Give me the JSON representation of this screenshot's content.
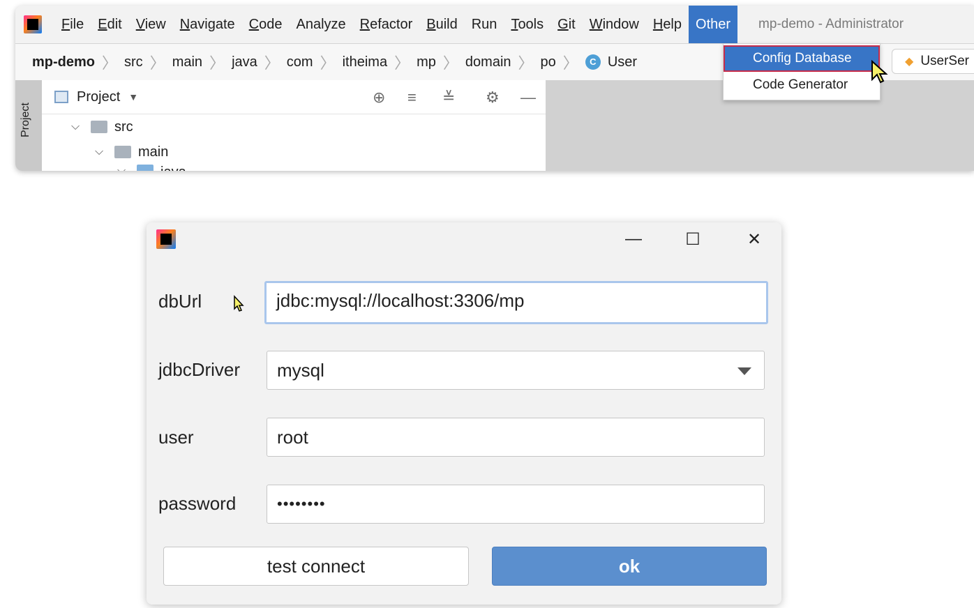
{
  "ide": {
    "menu": [
      {
        "label": "File",
        "mn": "F",
        "rest": "ile"
      },
      {
        "label": "Edit",
        "mn": "E",
        "rest": "dit"
      },
      {
        "label": "View",
        "mn": "V",
        "rest": "iew"
      },
      {
        "label": "Navigate",
        "mn": "N",
        "rest": "avigate"
      },
      {
        "label": "Code",
        "mn": "C",
        "rest": "ode"
      },
      {
        "label": "Analyze",
        "mn": "",
        "rest": "Analyze"
      },
      {
        "label": "Refactor",
        "mn": "R",
        "rest": "efactor"
      },
      {
        "label": "Build",
        "mn": "B",
        "rest": "uild"
      },
      {
        "label": "Run",
        "mn": "",
        "rest": "Run"
      },
      {
        "label": "Tools",
        "mn": "T",
        "rest": "ools"
      },
      {
        "label": "Git",
        "mn": "G",
        "rest": "it"
      },
      {
        "label": "Window",
        "mn": "W",
        "rest": "indow"
      },
      {
        "label": "Help",
        "mn": "H",
        "rest": "elp"
      },
      {
        "label": "Other",
        "mn": "",
        "rest": "Other"
      }
    ],
    "window_title": "mp-demo - Administrator",
    "breadcrumbs": [
      "mp-demo",
      "src",
      "main",
      "java",
      "com",
      "itheima",
      "mp",
      "domain",
      "po",
      "User"
    ],
    "class_icon_letter": "C",
    "editor_tab": "UserSer",
    "project_panel": {
      "title": "Project",
      "side_label": "Project",
      "tree": [
        {
          "label": "src"
        },
        {
          "label": "main"
        },
        {
          "label": "java"
        }
      ]
    },
    "other_menu": {
      "items": [
        "Config Database",
        "Code Generator"
      ]
    }
  },
  "dialog": {
    "fields": {
      "dbUrl": {
        "label": "dbUrl",
        "value": "jdbc:mysql://localhost:3306/mp"
      },
      "jdbcDriver": {
        "label": "jdbcDriver",
        "value": "mysql"
      },
      "user": {
        "label": "user",
        "value": "root"
      },
      "password": {
        "label": "password",
        "value": "••••••••"
      }
    },
    "buttons": {
      "test": "test connect",
      "ok": "ok"
    }
  },
  "colors": {
    "accent": "#3875c6",
    "ok_button": "#5b8fce",
    "highlight_border": "#c62b4a"
  }
}
